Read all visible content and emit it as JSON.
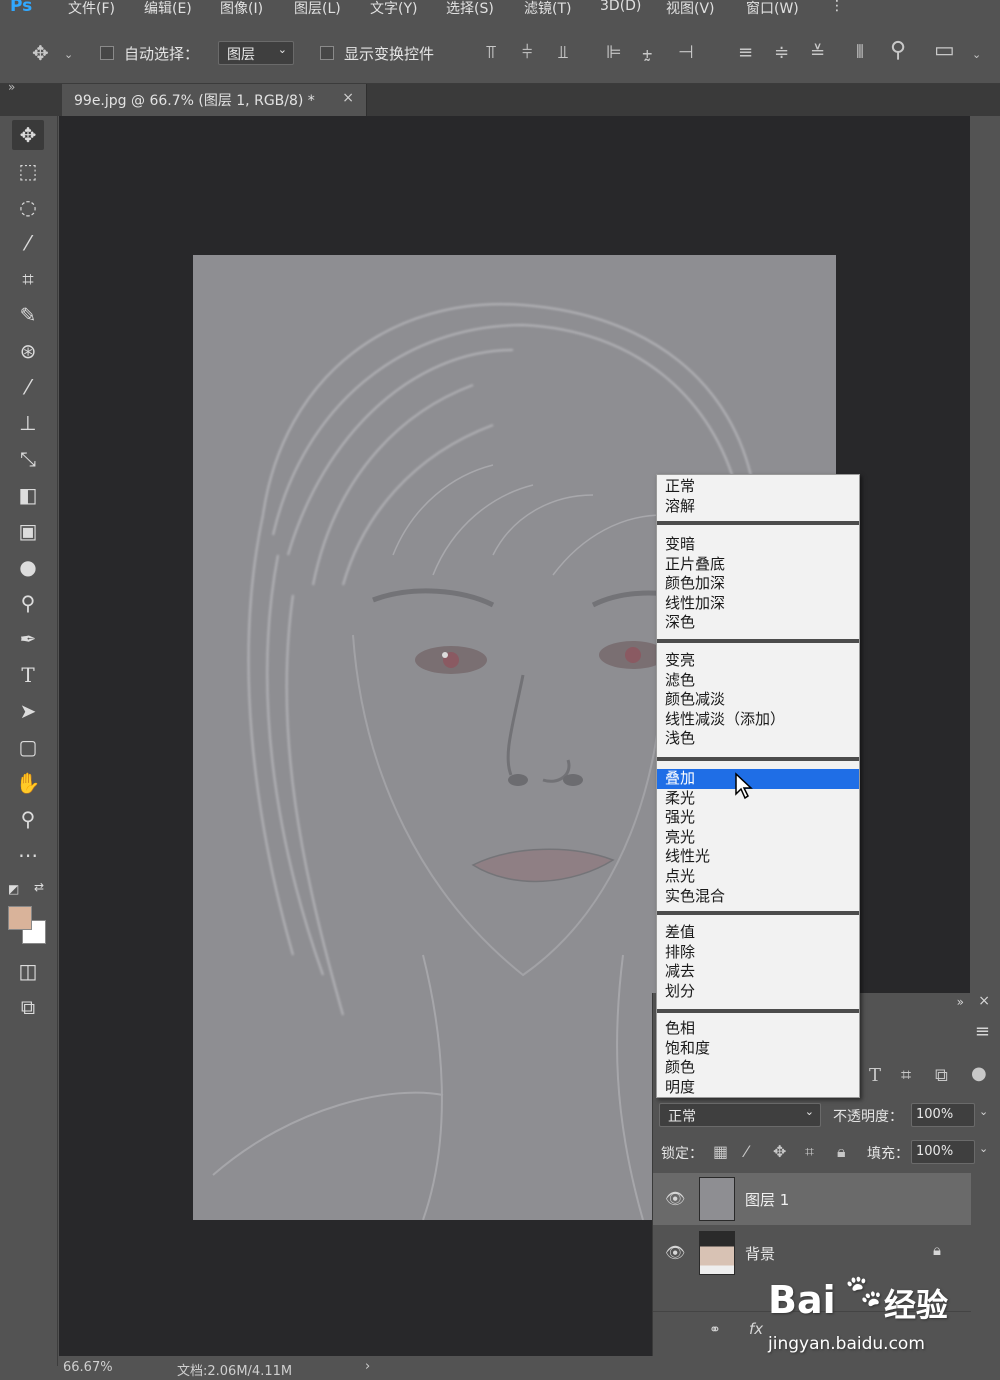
{
  "menu": {
    "logo": "Ps",
    "items": [
      "文件(F)",
      "编辑(E)",
      "图像(I)",
      "图层(L)",
      "文字(Y)",
      "选择(S)",
      "滤镜(T)",
      "3D(D)",
      "视图(V)",
      "窗口(W)"
    ]
  },
  "options": {
    "auto_select_label": "自动选择：",
    "auto_select_target": "图层",
    "show_transform_label": "显示变换控件"
  },
  "document": {
    "tab_title": "99e.jpg @ 66.7% (图层 1, RGB/8) *",
    "close_glyph": "×"
  },
  "status": {
    "zoom": "66.67%",
    "doc_size": "文档:2.06M/4.11M",
    "arrow": "›"
  },
  "blend_menu": {
    "groups": [
      [
        "正常",
        "溶解"
      ],
      [
        "变暗",
        "正片叠底",
        "颜色加深",
        "线性加深",
        "深色"
      ],
      [
        "变亮",
        "滤色",
        "颜色减淡",
        "线性减淡（添加）",
        "浅色"
      ],
      [
        "叠加",
        "柔光",
        "强光",
        "亮光",
        "线性光",
        "点光",
        "实色混合"
      ],
      [
        "差值",
        "排除",
        "减去",
        "划分"
      ],
      [
        "色相",
        "饱和度",
        "颜色",
        "明度"
      ]
    ],
    "selected": "叠加"
  },
  "layers_panel": {
    "blend_mode": "正常",
    "opacity_label": "不透明度：",
    "opacity_value": "100%",
    "lock_label": "锁定：",
    "fill_label": "填充：",
    "fill_value": "100%",
    "layers": [
      {
        "name": "图层 1"
      },
      {
        "name": "背景"
      }
    ],
    "footer_icons": "fx"
  },
  "watermark": {
    "brand": "Bai",
    "brand2": "经验",
    "url": "jingyan.baidu.com"
  },
  "colors": {
    "accent": "#1f6ee6",
    "foreground_swatch": "#d9b39a",
    "background_swatch": "#ffffff",
    "canvas_gray": "#8e8e92"
  }
}
